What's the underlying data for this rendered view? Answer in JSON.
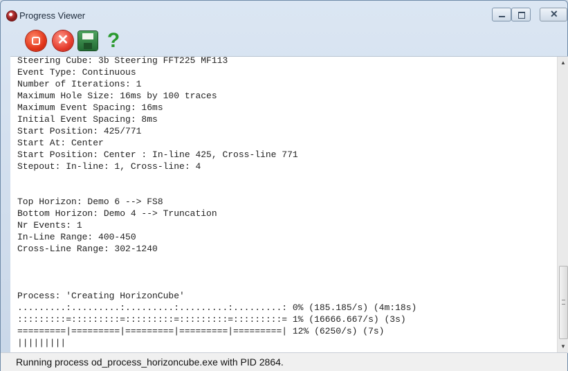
{
  "window": {
    "title": "Progress Viewer"
  },
  "toolbar": {
    "stop_icon": "stop-icon",
    "cancel_icon": "cancel-icon",
    "save_icon": "save-icon",
    "help_label": "?"
  },
  "log": {
    "text": "Steering Cube: 3b Steering FFT225 MF113\nEvent Type: Continuous\nNumber of Iterations: 1\nMaximum Hole Size: 16ms by 100 traces\nMaximum Event Spacing: 16ms\nInitial Event Spacing: 8ms\nStart Position: 425/771\nStart At: Center\nStart Position: Center : In-line 425, Cross-line 771\nStepout: In-line: 1, Cross-line: 4\n\n\nTop Horizon: Demo 6 --> FS8\nBottom Horizon: Demo 4 --> Truncation\nNr Events: 1\nIn-Line Range: 400-450\nCross-Line Range: 302-1240\n\n\n\nProcess: 'Creating HorizonCube'\n.........:.........:.........:.........:.........: 0% (185.185/s) (4m:18s)\n:::::::::=:::::::::=:::::::::=:::::::::=:::::::::= 1% (16666.667/s) (3s)\n=========|=========|=========|=========|=========| 12% (6250/s) (7s)\n|||||||||"
  },
  "status": {
    "text": "Running process od_process_horizoncube.exe with PID 2864."
  }
}
